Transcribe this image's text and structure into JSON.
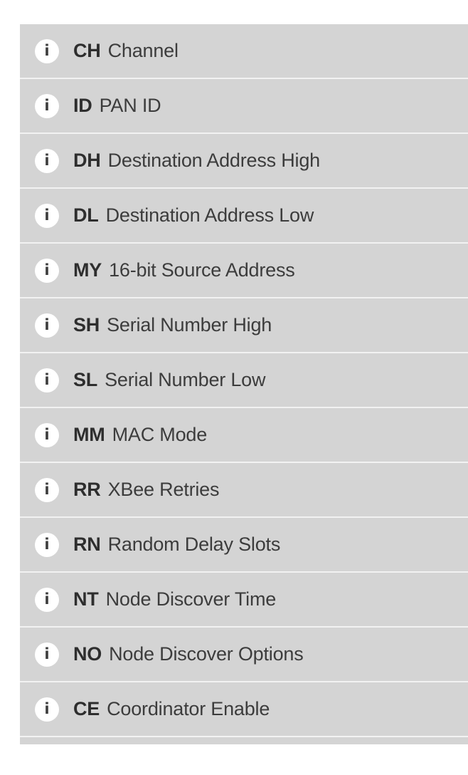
{
  "parameters": [
    {
      "command": "CH",
      "name": "Channel",
      "icon": "info-icon",
      "icon_glyph": "i"
    },
    {
      "command": "ID",
      "name": "PAN ID",
      "icon": "info-icon",
      "icon_glyph": "i"
    },
    {
      "command": "DH",
      "name": "Destination Address High",
      "icon": "info-icon",
      "icon_glyph": "i"
    },
    {
      "command": "DL",
      "name": "Destination Address Low",
      "icon": "info-icon",
      "icon_glyph": "i"
    },
    {
      "command": "MY",
      "name": "16-bit Source Address",
      "icon": "info-icon",
      "icon_glyph": "i"
    },
    {
      "command": "SH",
      "name": "Serial Number High",
      "icon": "info-icon",
      "icon_glyph": "i"
    },
    {
      "command": "SL",
      "name": "Serial Number Low",
      "icon": "info-icon",
      "icon_glyph": "i"
    },
    {
      "command": "MM",
      "name": "MAC Mode",
      "icon": "info-icon",
      "icon_glyph": "i"
    },
    {
      "command": "RR",
      "name": "XBee Retries",
      "icon": "info-icon",
      "icon_glyph": "i"
    },
    {
      "command": "RN",
      "name": "Random Delay Slots",
      "icon": "info-icon",
      "icon_glyph": "i"
    },
    {
      "command": "NT",
      "name": "Node Discover Time",
      "icon": "info-icon",
      "icon_glyph": "i"
    },
    {
      "command": "NO",
      "name": "Node Discover Options",
      "icon": "info-icon",
      "icon_glyph": "i"
    },
    {
      "command": "CE",
      "name": "Coordinator Enable",
      "icon": "info-icon",
      "icon_glyph": "i"
    }
  ],
  "colors": {
    "row_background": "#d4d4d4",
    "row_separator": "#f2f2f2",
    "icon_background": "#ffffff",
    "text": "#3c3c3c"
  }
}
